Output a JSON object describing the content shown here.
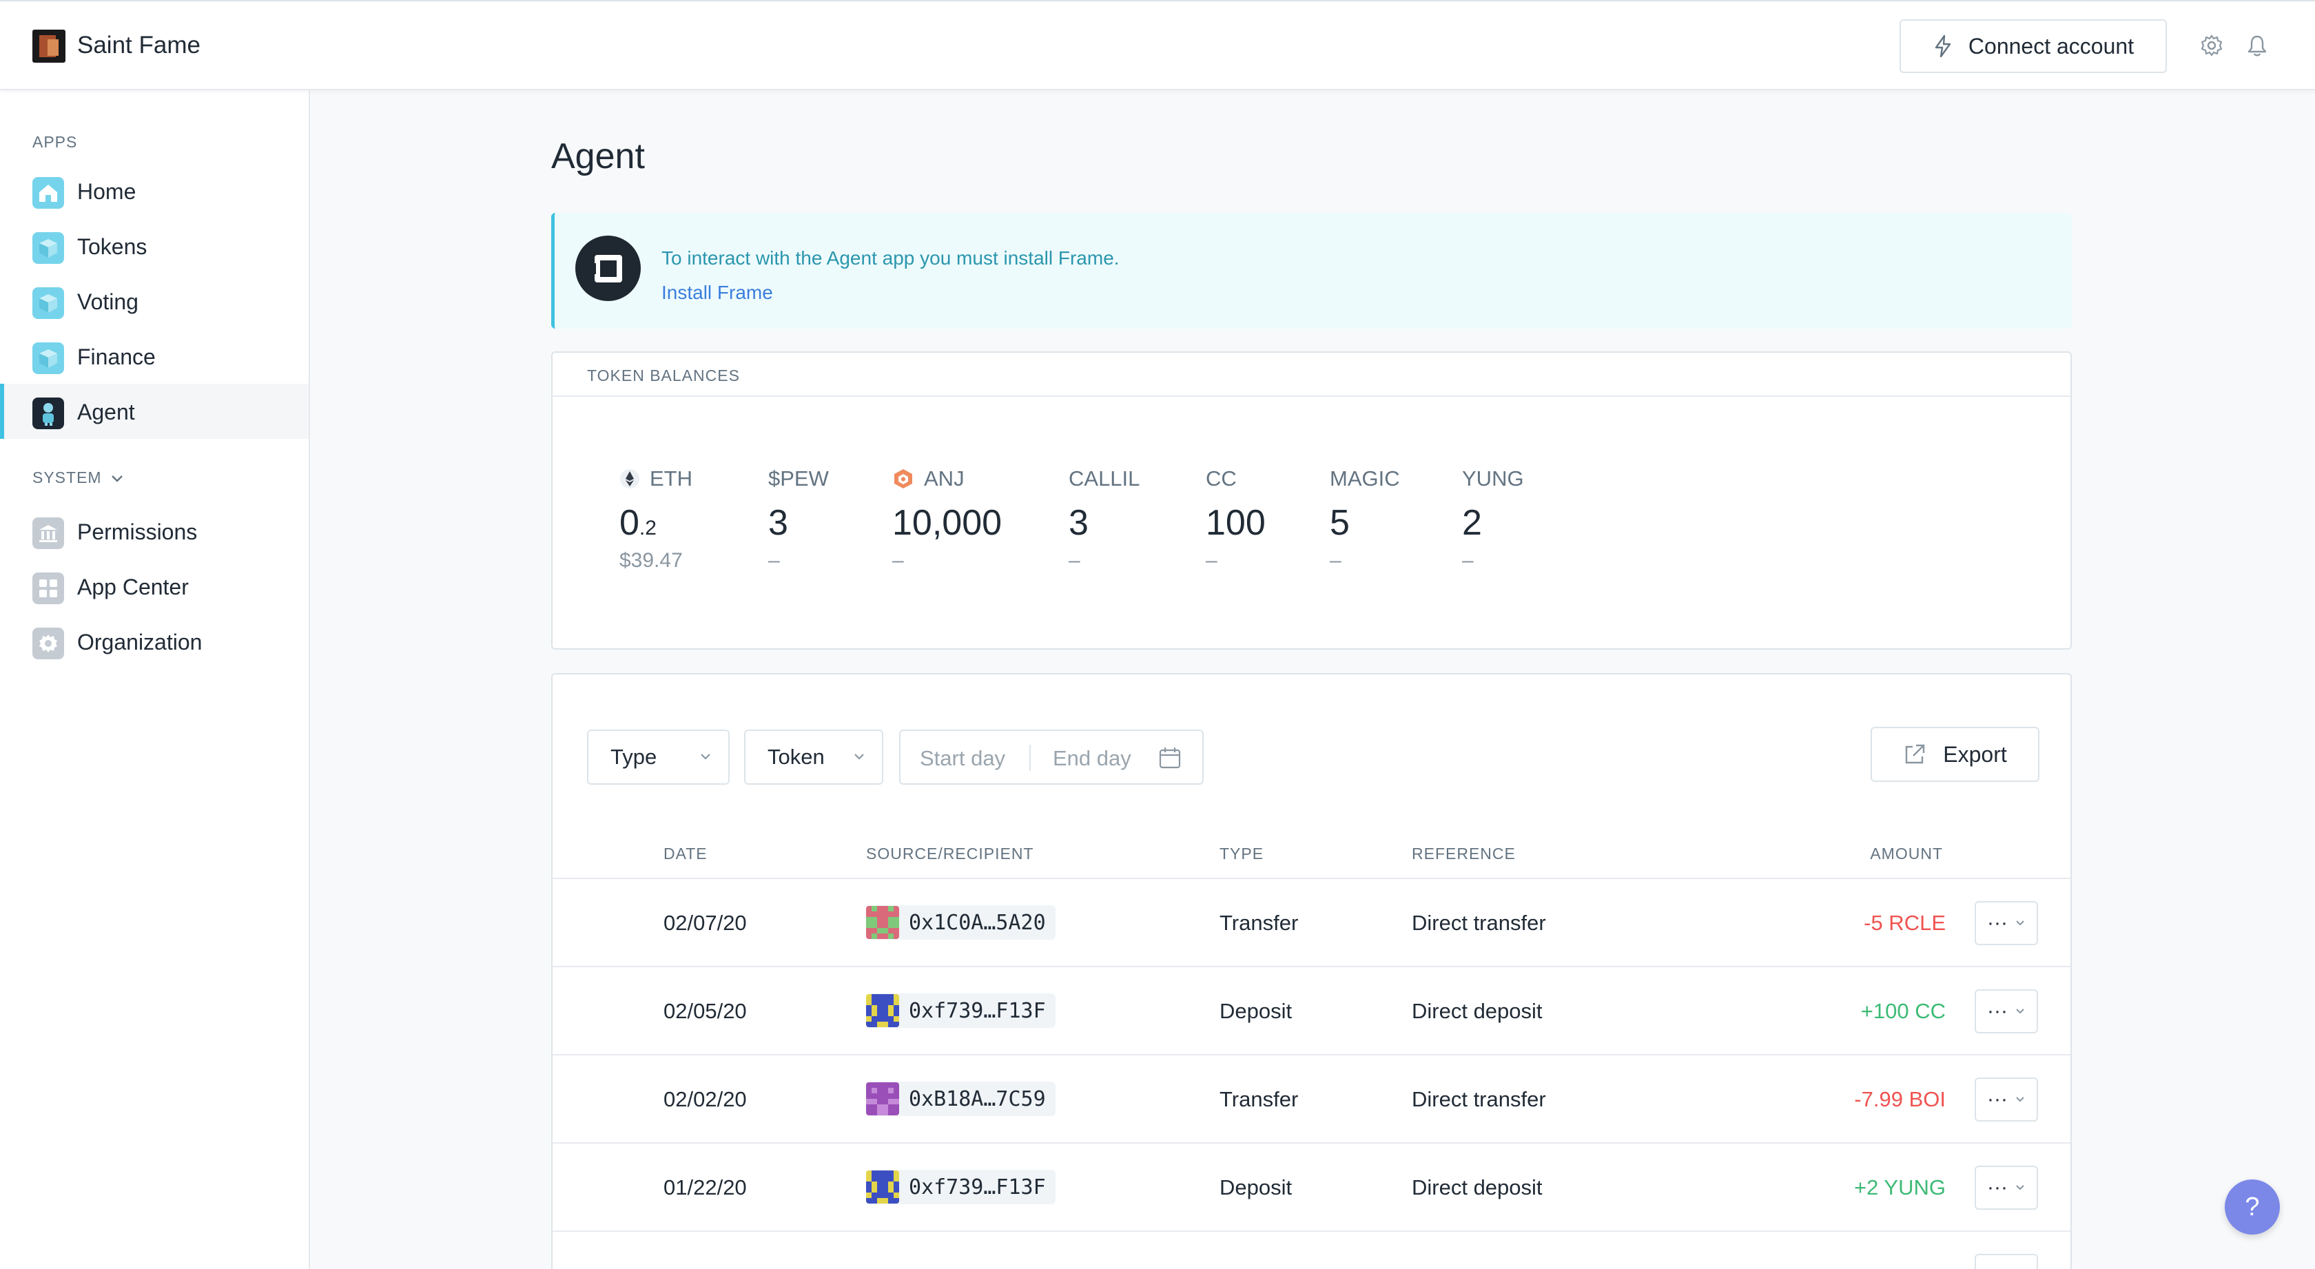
{
  "header": {
    "org_name": "Saint Fame",
    "connect_label": "Connect account",
    "icons": [
      "bolt-icon",
      "gear-icon",
      "bell-icon"
    ]
  },
  "sidebar": {
    "apps_label": "APPS",
    "system_label": "SYSTEM",
    "apps": [
      {
        "label": "Home",
        "icon": "home-icon"
      },
      {
        "label": "Tokens",
        "icon": "cube-icon"
      },
      {
        "label": "Voting",
        "icon": "cube-icon"
      },
      {
        "label": "Finance",
        "icon": "cube-icon"
      },
      {
        "label": "Agent",
        "icon": "agent-icon",
        "active": true
      }
    ],
    "system": [
      {
        "label": "Permissions",
        "icon": "bank-icon"
      },
      {
        "label": "App Center",
        "icon": "grid-icon"
      },
      {
        "label": "Organization",
        "icon": "gear-icon"
      }
    ]
  },
  "main": {
    "title": "Agent",
    "notice": {
      "text": "To interact with the Agent app you must install Frame.",
      "link": "Install Frame"
    },
    "balances": {
      "title": "TOKEN BALANCES",
      "tokens": [
        {
          "symbol": "ETH",
          "amount_int": "0",
          "amount_dec": ".2",
          "usd": "$39.47"
        },
        {
          "symbol": "$PEW",
          "amount_int": "3",
          "amount_dec": "",
          "usd": "–"
        },
        {
          "symbol": "ANJ",
          "amount_int": "10,000",
          "amount_dec": "",
          "usd": "–"
        },
        {
          "symbol": "CALLIL",
          "amount_int": "3",
          "amount_dec": "",
          "usd": "–"
        },
        {
          "symbol": "CC",
          "amount_int": "100",
          "amount_dec": "",
          "usd": "–"
        },
        {
          "symbol": "MAGIC",
          "amount_int": "5",
          "amount_dec": "",
          "usd": "–"
        },
        {
          "symbol": "YUNG",
          "amount_int": "2",
          "amount_dec": "",
          "usd": "–"
        }
      ]
    },
    "filters": {
      "type_label": "Type",
      "token_label": "Token",
      "start_placeholder": "Start day",
      "end_placeholder": "End day",
      "export_label": "Export"
    },
    "table": {
      "columns": {
        "date": "DATE",
        "source": "SOURCE/RECIPIENT",
        "type": "TYPE",
        "reference": "REFERENCE",
        "amount": "AMOUNT"
      },
      "rows": [
        {
          "date": "02/07/20",
          "address": "0x1C0A…5A20",
          "type": "Transfer",
          "reference": "Direct transfer",
          "amount": "-5 RCLE",
          "sign": "neg",
          "avatar_colors": [
            "#d96a7a",
            "#7fc97a"
          ]
        },
        {
          "date": "02/05/20",
          "address": "0xf739…F13F",
          "type": "Deposit",
          "reference": "Direct deposit",
          "amount": "+100 CC",
          "sign": "pos",
          "avatar_colors": [
            "#3c4fc2",
            "#e3d54a"
          ]
        },
        {
          "date": "02/02/20",
          "address": "0xB18A…7C59",
          "type": "Transfer",
          "reference": "Direct transfer",
          "amount": "-7.99 BOI",
          "sign": "neg",
          "avatar_colors": [
            "#9a4fb8",
            "#c58ad9"
          ]
        },
        {
          "date": "01/22/20",
          "address": "0xf739…F13F",
          "type": "Deposit",
          "reference": "Direct deposit",
          "amount": "+2 YUNG",
          "sign": "pos",
          "avatar_colors": [
            "#3c4fc2",
            "#e3d54a"
          ]
        }
      ],
      "row_menu_label": "···"
    },
    "help_label": "?"
  },
  "colors": {
    "accent": "#40c1e1",
    "negative": "#ef5350",
    "positive": "#3dba75",
    "link": "#3b7edc",
    "help": "#7b88e8"
  }
}
